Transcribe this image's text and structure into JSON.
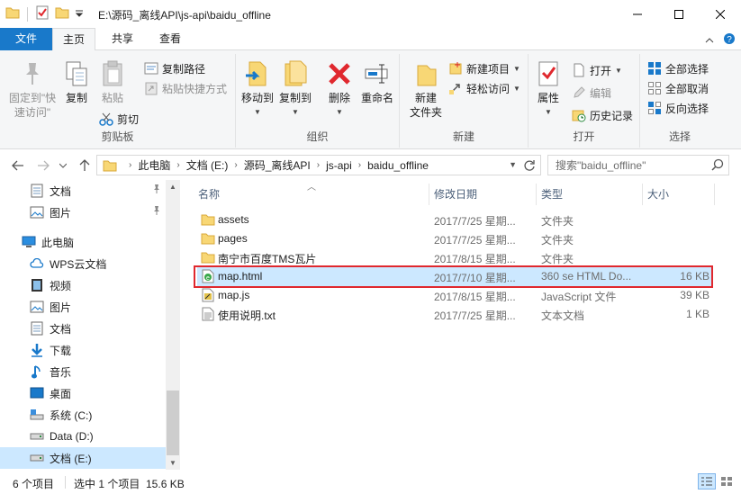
{
  "window": {
    "title": "E:\\源码_离线API\\js-api\\baidu_offline"
  },
  "ribbon_tabs": [
    "文件",
    "主页",
    "共享",
    "查看"
  ],
  "clipboard": {
    "pin_label_1": "固定到\"快",
    "pin_label_2": "速访问\"",
    "copy": "复制",
    "paste": "粘贴",
    "copy_path": "复制路径",
    "paste_shortcut": "粘贴快捷方式",
    "cut": "剪切",
    "group": "剪贴板"
  },
  "organize": {
    "move_to": "移动到",
    "copy_to": "复制到",
    "delete": "删除",
    "rename": "重命名",
    "group": "组织"
  },
  "new": {
    "new_folder_1": "新建",
    "new_folder_2": "文件夹",
    "new_item": "新建项目",
    "easy_access": "轻松访问",
    "group": "新建"
  },
  "open": {
    "properties": "属性",
    "open": "打开",
    "edit": "编辑",
    "history": "历史记录",
    "group": "打开"
  },
  "select": {
    "select_all": "全部选择",
    "select_none": "全部取消",
    "invert": "反向选择",
    "group": "选择"
  },
  "address": {
    "crumbs": [
      "此电脑",
      "文档 (E:)",
      "源码_离线API",
      "js-api",
      "baidu_offline"
    ]
  },
  "search": {
    "placeholder": "搜索\"baidu_offline\""
  },
  "nav_pane": {
    "items": [
      {
        "label": "文档",
        "icon": "document-icon",
        "pinned": true
      },
      {
        "label": "图片",
        "icon": "picture-icon",
        "pinned": true
      },
      {
        "label": "此电脑",
        "icon": "computer-icon"
      },
      {
        "label": "WPS云文档",
        "icon": "cloud-icon"
      },
      {
        "label": "视频",
        "icon": "video-icon"
      },
      {
        "label": "图片",
        "icon": "picture-icon"
      },
      {
        "label": "文档",
        "icon": "document-icon"
      },
      {
        "label": "下载",
        "icon": "download-icon"
      },
      {
        "label": "音乐",
        "icon": "music-icon"
      },
      {
        "label": "桌面",
        "icon": "desktop-icon"
      },
      {
        "label": "系统 (C:)",
        "icon": "system-drive-icon"
      },
      {
        "label": "Data (D:)",
        "icon": "drive-icon"
      },
      {
        "label": "文档 (E:)",
        "icon": "drive-icon",
        "selected": true
      }
    ]
  },
  "columns": {
    "name": "名称",
    "date": "修改日期",
    "type": "类型",
    "size": "大小"
  },
  "files": [
    {
      "name": "assets",
      "date": "2017/7/25 星期...",
      "type": "文件夹",
      "size": "",
      "icon": "folder-icon"
    },
    {
      "name": "pages",
      "date": "2017/7/25 星期...",
      "type": "文件夹",
      "size": "",
      "icon": "folder-icon"
    },
    {
      "name": "南宁市百度TMS瓦片",
      "date": "2017/8/15 星期...",
      "type": "文件夹",
      "size": "",
      "icon": "folder-icon"
    },
    {
      "name": "map.html",
      "date": "2017/7/10 星期...",
      "type": "360 se HTML Do...",
      "size": "16 KB",
      "icon": "html-file-icon",
      "selected": true
    },
    {
      "name": "map.js",
      "date": "2017/8/15 星期...",
      "type": "JavaScript 文件",
      "size": "39 KB",
      "icon": "js-file-icon"
    },
    {
      "name": "使用说明.txt",
      "date": "2017/7/25 星期...",
      "type": "文本文档",
      "size": "1 KB",
      "icon": "text-file-icon"
    }
  ],
  "status": {
    "count": "6 个项目",
    "selection": "选中 1 个项目  15.6 KB"
  },
  "colors": {
    "accent": "#1979ca",
    "selection": "#cce8ff",
    "highlight_border": "#e0282e",
    "folder": "#f8d775"
  }
}
